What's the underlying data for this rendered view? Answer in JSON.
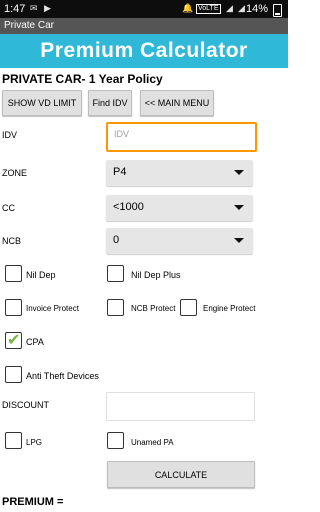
{
  "status_bar": {
    "time": "1:47",
    "volte": "VoLTE",
    "battery_pct": "14%"
  },
  "action_bar": {
    "title": "Private Car"
  },
  "banner": {
    "title": "Premium Calculator"
  },
  "policy_title": "PRIVATE CAR- 1 Year Policy",
  "buttons": {
    "show_vd_limit": "SHOW VD LIMIT",
    "find_idv": "Find IDV",
    "main_menu": "<< MAIN MENU"
  },
  "fields": {
    "idv_label": "IDV",
    "idv_placeholder": "IDV",
    "zone_label": "ZONE",
    "zone_value": "P4",
    "cc_label": "CC",
    "cc_value": "<1000",
    "ncb_label": "NCB",
    "ncb_value": "0",
    "discount_label": "DISCOUNT"
  },
  "checkboxes": {
    "nil_dep": "Nil Dep",
    "nil_dep_plus": "Nil Dep Plus",
    "invoice_protect": "Invoice Protect",
    "ncb_protect": "NCB Protect",
    "engine_protect": "Engine Protect",
    "cpa": "CPA",
    "anti_theft": "Anti Theft Devices",
    "lpg": "LPG",
    "unamed_pa": "Unamed PA"
  },
  "checked": {
    "cpa": true
  },
  "calculate_label": "CALCULATE",
  "premium_label": "PREMIUM ="
}
